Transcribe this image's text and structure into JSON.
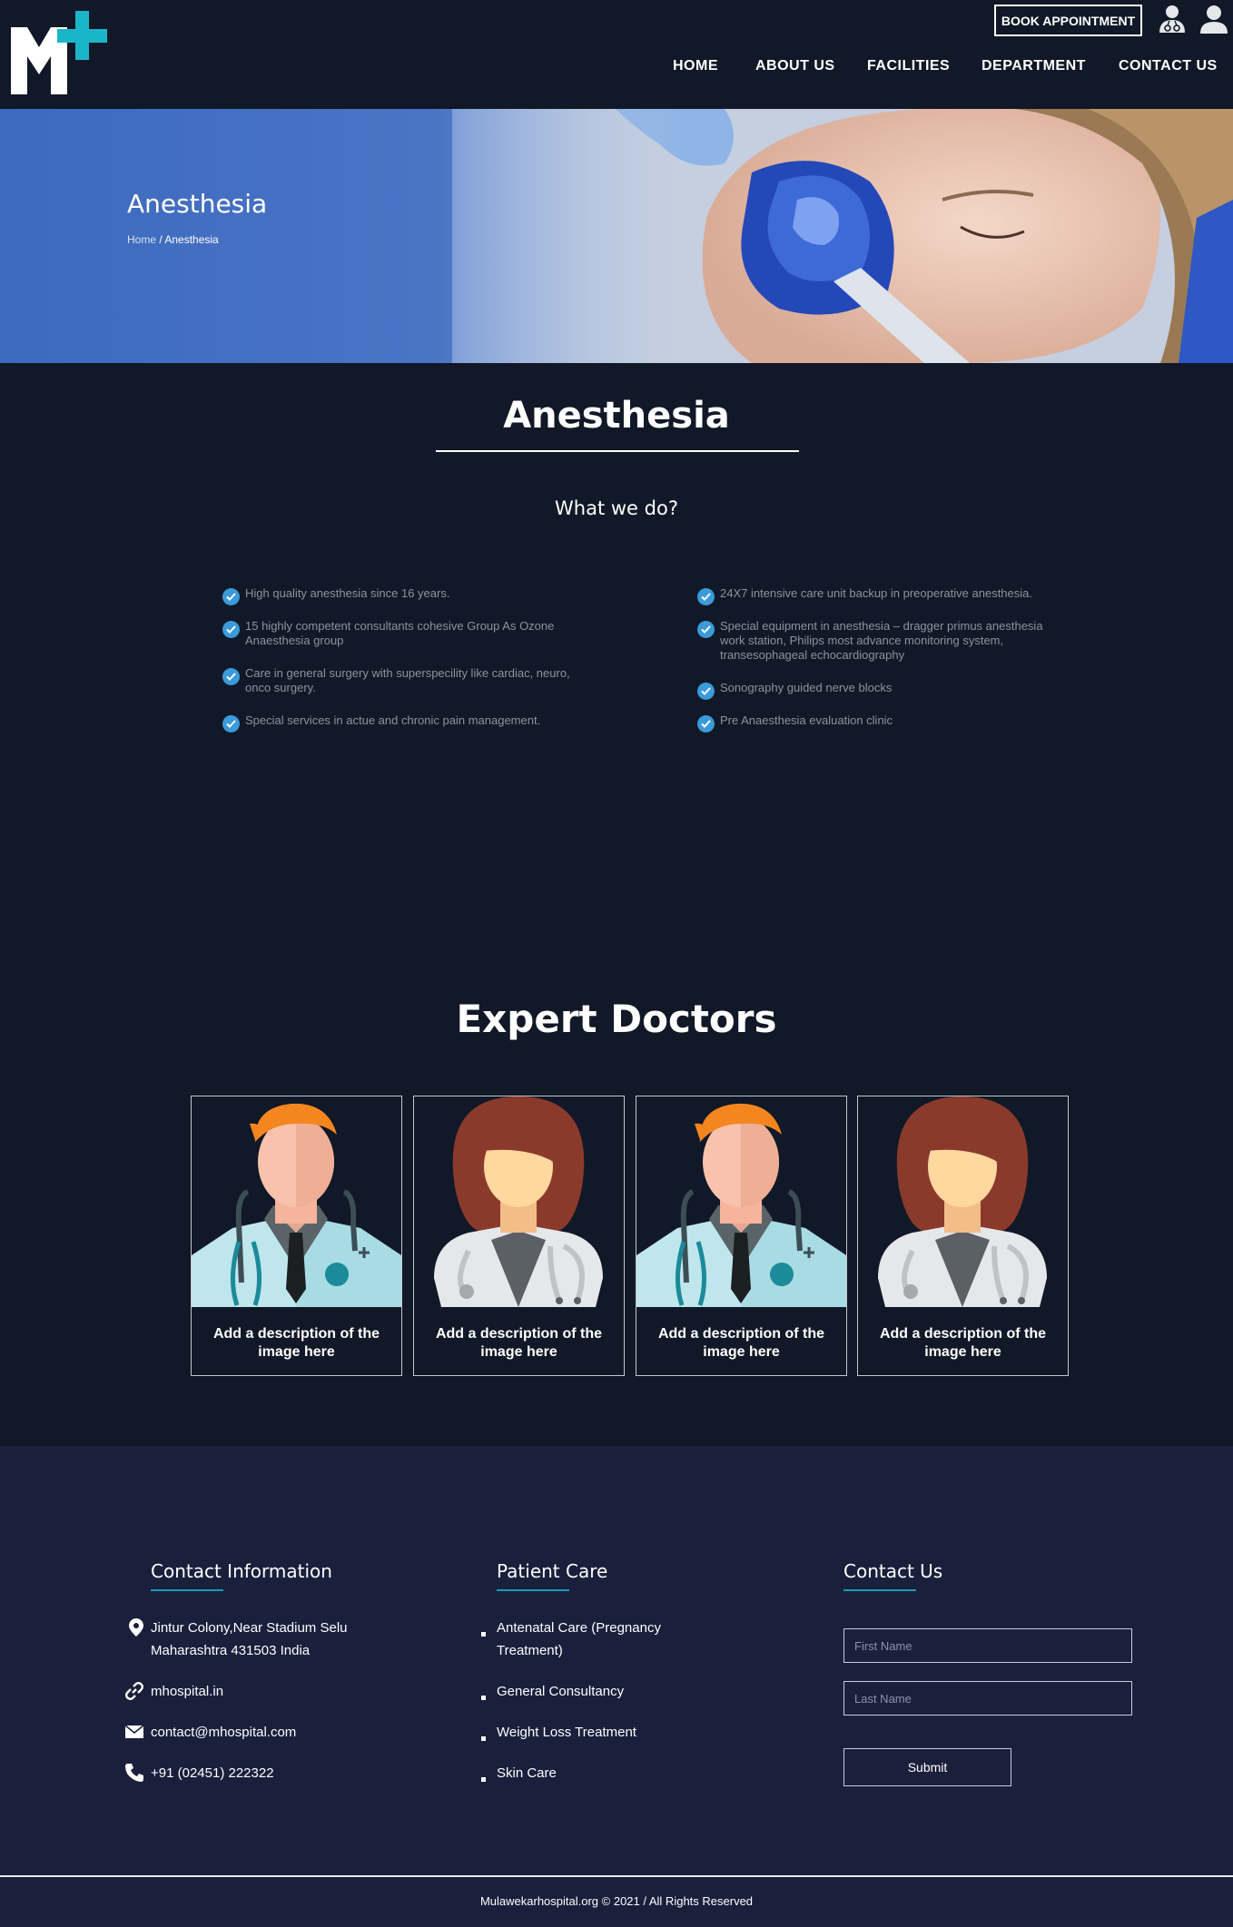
{
  "header": {
    "logo_text": "M+",
    "book_button": "BOOK APPOINTMENT",
    "icons": [
      "doctor-icon",
      "user-icon"
    ],
    "nav": [
      "HOME",
      "ABOUT US",
      "FACILITIES",
      "DEPARTMENT",
      "CONTACT US"
    ]
  },
  "hero": {
    "title": "Anesthesia",
    "breadcrumb": {
      "home": "Home",
      "separator": " / ",
      "current": "Anesthesia"
    }
  },
  "main": {
    "title": "Anesthesia",
    "subtitle": "What we do?",
    "features_left": [
      "High quality anesthesia since 16 years.",
      "15 highly competent consultants cohesive Group As Ozone Anaesthesia group",
      "Care in general surgery with superspecility like cardiac, neuro, onco surgery.",
      "Special services in actue and chronic pain management."
    ],
    "features_right": [
      "24X7 intensive care unit backup in preoperative anesthesia.",
      "Special equipment in anesthesia – dragger primus anesthesia work station, Philips most advance monitoring system, transesophageal echocardiography",
      "Sonography guided nerve blocks",
      "Pre Anaesthesia evaluation clinic"
    ]
  },
  "doctors": {
    "title": "Expert Doctors",
    "cards": [
      {
        "avatar": "male-doctor",
        "caption": "Add a description of the image here"
      },
      {
        "avatar": "female-doctor",
        "caption": "Add a description of the image here"
      },
      {
        "avatar": "male-doctor",
        "caption": "Add a description of the image here"
      },
      {
        "avatar": "female-doctor",
        "caption": "Add a description of the image here"
      }
    ]
  },
  "footer": {
    "contact_info": {
      "heading": "Contact Information",
      "address_line1": "Jintur Colony,Near Stadium Selu",
      "address_line2": "Maharashtra 431503 India",
      "website": "mhospital.in",
      "email": "contact@mhospital.com",
      "phone": "+91 (02451) 222322"
    },
    "patient_care": {
      "heading": "Patient Care",
      "items": [
        "Antenatal Care (Pregnancy Treatment)",
        "General Consultancy",
        "Weight Loss Treatment",
        "Skin Care"
      ]
    },
    "contact_form": {
      "heading": "Contact Us",
      "first_name_placeholder": "First Name",
      "last_name_placeholder": "Last Name",
      "submit": "Submit"
    },
    "copyright": "Mulawekarhospital.org © 2021 / All Rights Reserved"
  },
  "colors": {
    "background": "#111827",
    "footer_bg": "#1a1f3c",
    "accent_teal": "#1bb5c9",
    "check_blue": "#3b9ad9",
    "hero_blue": "#3d6abf"
  }
}
